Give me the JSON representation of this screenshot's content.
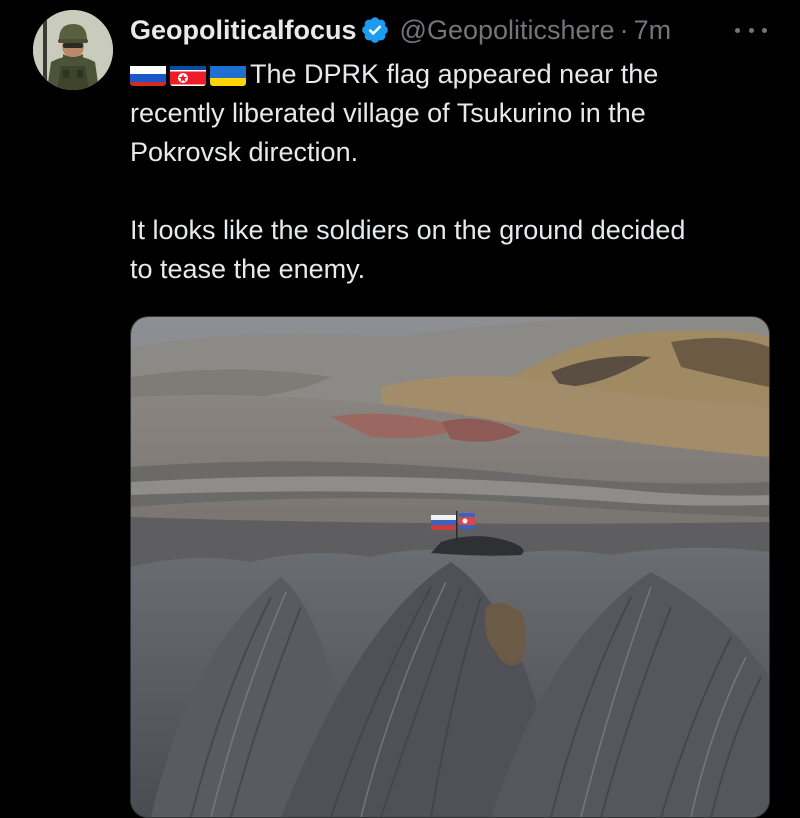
{
  "author": {
    "display_name": "Geopoliticalfocus",
    "handle": "@Geopoliticshere",
    "separator": "·",
    "time": "7m",
    "avatar_icon": "soldier-avatar",
    "verified_icon": "verified-badge-icon",
    "verified_color": "#1d9bf0"
  },
  "tweet": {
    "flags": [
      "russia-flag-icon",
      "north-korea-flag-icon",
      "ukraine-flag-icon"
    ],
    "line1": "The DPRK flag appeared near the",
    "line2": "recently liberated village of Tsukurino in the",
    "line3": "Pokrovsk direction.",
    "line4": "It looks like the soldiers on the ground decided",
    "line5": "to tease the enemy."
  },
  "media": {
    "type": "photo",
    "subject": "flags-on-spoil-tip-photo"
  },
  "colors": {
    "background": "#000000",
    "text": "#e7e9ea",
    "secondary_text": "#71767b"
  }
}
